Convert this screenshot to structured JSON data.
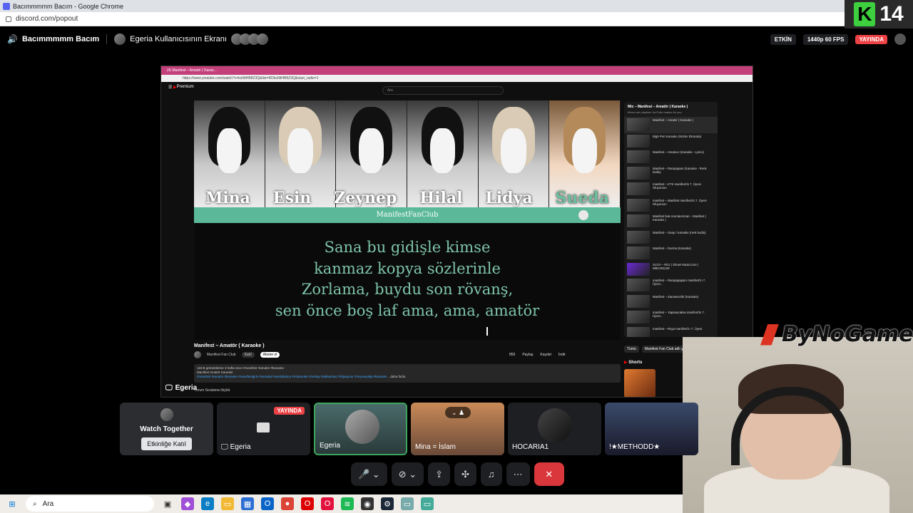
{
  "browser": {
    "window_title": "Bacımmmmm Bacım - Google Chrome",
    "url": "discord.com/popout"
  },
  "overlay_logo": {
    "letter": "K",
    "number": "14"
  },
  "header": {
    "channel": "Bacımmmmm Bacım",
    "stream_title": "Egeria Kullanıcısının Ekranı",
    "badge_active": "ETKİN",
    "quality": "1440p 60 FPS",
    "live": "YAYINDA"
  },
  "stream": {
    "inner_tab": "(4) Manifest – Amatör ( Karao...",
    "inner_url": "https://www.youtube.com/watch?v=ks0ttHB8Z3Q&list=RDks0ttHB8Z3Q&start_radio=1",
    "yt_premium": "Premium",
    "yt_search_placeholder": "Ara",
    "video": {
      "names": [
        "Mina",
        "Esin",
        "Zeynep",
        "Hilal",
        "Lidya",
        "Sueda"
      ],
      "fan_bar": "ManifestFanClub",
      "lyrics": [
        "Sana bu gidişle kimse",
        "kanmaz kopya sözlerinle",
        "Zorlama, buydu son rövanş,",
        "sen önce boş laf ama, ama, amatör"
      ]
    },
    "video_title": "Manifest – Amatör ( Karaoke )",
    "channel": "Manifest Fan Club",
    "join": "Katıl",
    "subscribe": "Abone ol",
    "actions": [
      "859",
      "Paylaş",
      "Kaydet",
      "İndir"
    ],
    "desc_line1": "118 B görüntüleme  3 hafta önce  #manifest #amatör #karaoke",
    "desc_line2": "Manifest Amatör Karaoke",
    "desc_tags": "#manifest #amatör #karaoke #manifestgirls #sertabal #aardabulca #rmbanoke #zerkay #aldeyinkuz #tilyaqrour #zeynepolap #karaoke",
    "desc_more": "...daha fazla",
    "comments": "Yorum   Sıralama ölçütü",
    "label": "Egeria",
    "playlist": {
      "title": "Mix – Manifest – Amatör ( Karaoke )",
      "subtitle": "Mixes are playlists YouTube makes for you",
      "items": [
        "Manifest – Amatör ( Karaoke )",
        "Big5 Peri Karaoke (Sözler Ekranda)",
        "Manifest – Amateur (Karaoke - Lyrics)",
        "Manifest – Rampapam (Karaoke - Renk kodlu)",
        "manifest – KTS manifest'in 7. Üyesi Oluyorsun",
        "manifest – Manifest manifest'in 7. Üyesi Oluyorsun",
        "Manifest feat Arem&Arman – Manifest ( Karaoke )",
        "Manifest – Snap / Karaoke (renk kodlu)",
        "Manifest – Durma (Karaoke)",
        "XLOV – Rizz | Show! MusicCore | MBC251129",
        "manifest – Rampapapam manifest'in 7. Üyesi...",
        "Manifest – Zamansızlık (Karaoke)",
        "manifest – Yapanacaksa manifest'in 7. Üyesi...",
        "manifest – Rüya manifest'in 7. Üyesi"
      ],
      "chips": [
        "Tümü",
        "Manifest Fan Club adlı yükle"
      ],
      "shorts": "Shorts"
    }
  },
  "sponsor": "ByNoGame",
  "tiles": {
    "watch_together": "Watch Together",
    "join_activity": "Etkinliğe Katıl",
    "t2": "Egeria",
    "t2_badge": "YAYINDA",
    "t3": "Egeria",
    "t4": "Mina = İslam",
    "t5": "HOCARIA1",
    "t6": "!★METHODD★"
  },
  "taskbar": {
    "search": "Ara"
  }
}
